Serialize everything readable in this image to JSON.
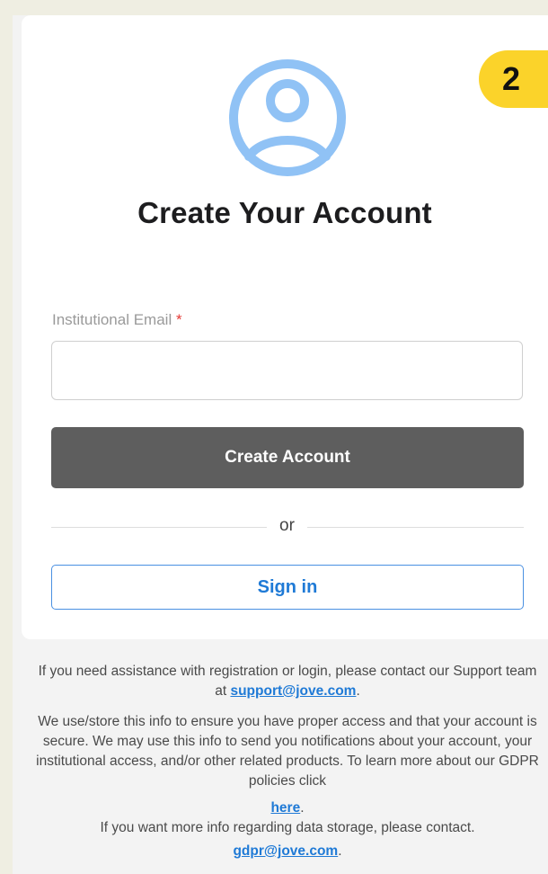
{
  "badge": {
    "step": "2"
  },
  "avatar": {
    "icon": "user-circle-icon",
    "color": "#90c2f5"
  },
  "title": "Create Your Account",
  "form": {
    "email_label": "Institutional Email",
    "required_marker": "*",
    "email_value": "",
    "create_button": "Create Account",
    "divider": "or",
    "signin_button": "Sign in"
  },
  "footer": {
    "assist_text_1": "If you need assistance with registration or login, please contact our Support team at ",
    "support_email": "support@jove.com",
    "assist_text_2": ".",
    "privacy_text": "We use/store this info to ensure you have proper access and that your account is secure. We may use this info to send you notifications about your account, your institutional access, and/or other related products. To learn more about our GDPR policies click",
    "here_link": "here",
    "here_suffix": ".",
    "storage_text": "If you want more info regarding data storage, please contact.",
    "gdpr_email": "gdpr@jove.com",
    "gdpr_suffix": "."
  },
  "colors": {
    "accent": "#fbd32a",
    "primary_button": "#5e5e5e",
    "link": "#1f7ad6"
  }
}
